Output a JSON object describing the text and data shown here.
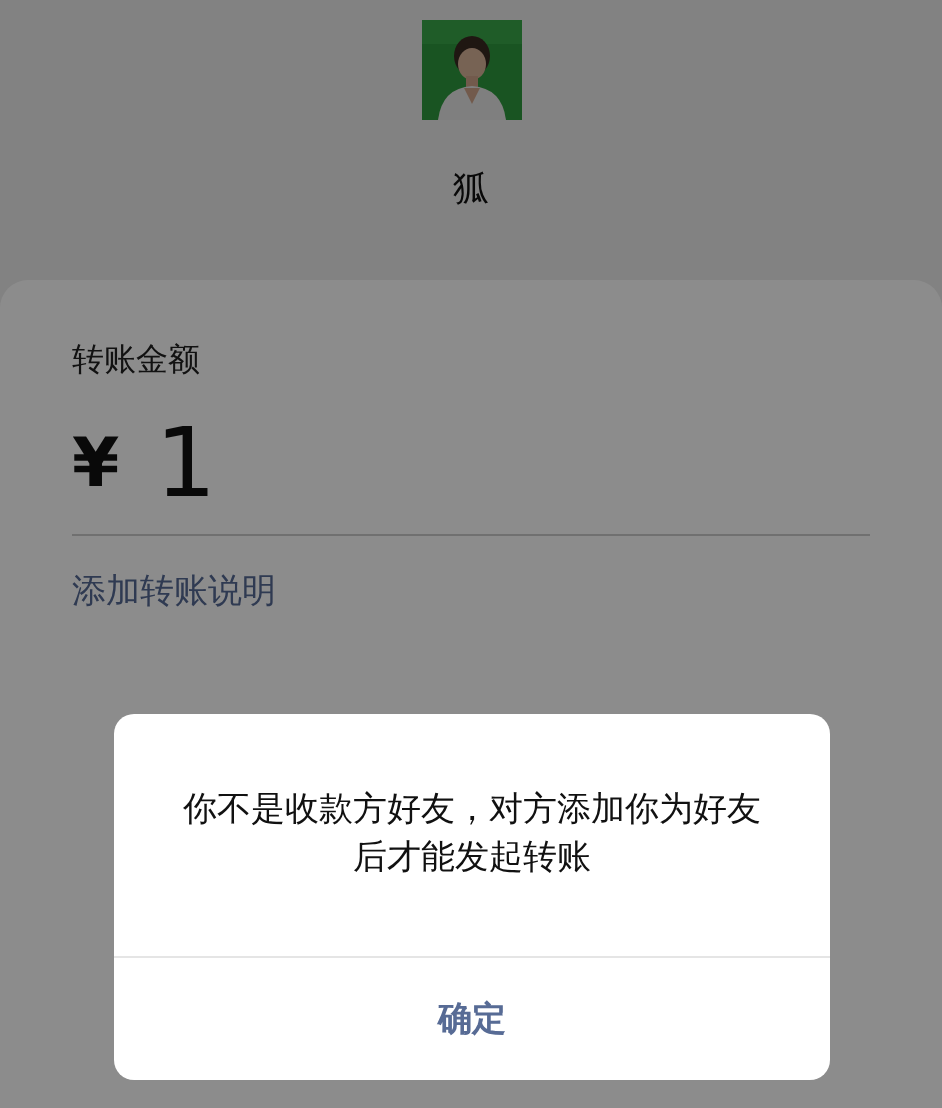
{
  "payee": {
    "name": "狐"
  },
  "transfer": {
    "amount_label": "转账金额",
    "currency": "¥",
    "amount": "1",
    "add_note_link": "添加转账说明"
  },
  "dialog": {
    "message": "你不是收款方好友，对方添加你为好友后才能发起转账",
    "buttons": [
      "确定"
    ]
  }
}
